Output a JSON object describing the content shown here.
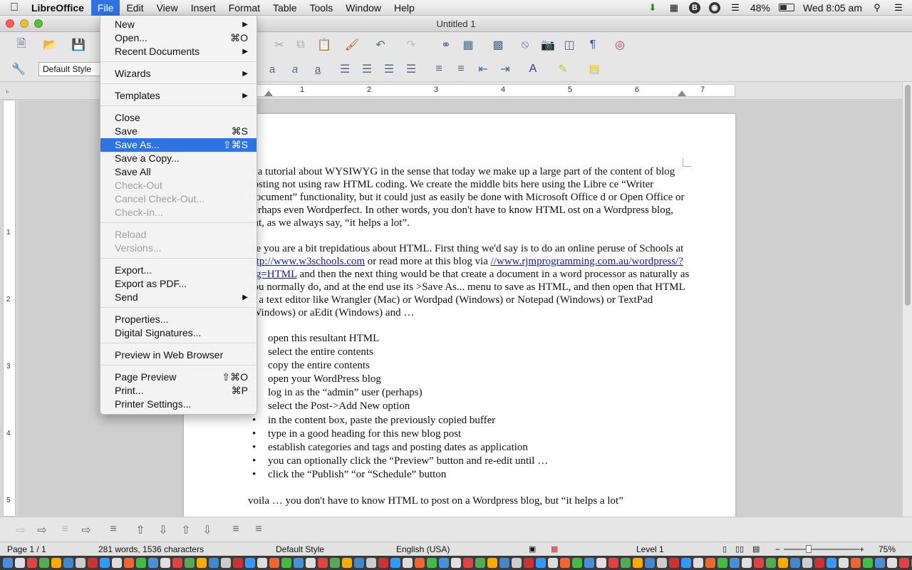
{
  "menubar": {
    "app_name": "LibreOffice",
    "menus": [
      "File",
      "Edit",
      "View",
      "Insert",
      "Format",
      "Table",
      "Tools",
      "Window",
      "Help"
    ],
    "active_menu": "File",
    "battery": "48%",
    "battery_level": 0.48,
    "clock": "Wed 8:05 am"
  },
  "window": {
    "title": "Untitled 1"
  },
  "toolbar": {
    "paragraph_style": "Default Style"
  },
  "ruler": {
    "numbers": [
      "1",
      "2",
      "3",
      "4",
      "5",
      "6",
      "7"
    ]
  },
  "vruler": {
    "numbers": [
      "1",
      "2",
      "3",
      "4",
      "5"
    ]
  },
  "file_menu": {
    "items": [
      {
        "label": "New",
        "shortcut": "",
        "submenu": true,
        "enabled": true
      },
      {
        "label": "Open...",
        "shortcut": "⌘O",
        "submenu": false,
        "enabled": true
      },
      {
        "label": "Recent Documents",
        "shortcut": "",
        "submenu": true,
        "enabled": true
      },
      {
        "label": "Wizards",
        "shortcut": "",
        "submenu": true,
        "enabled": true
      },
      {
        "label": "Templates",
        "shortcut": "",
        "submenu": true,
        "enabled": true
      },
      {
        "label": "Close",
        "shortcut": "",
        "submenu": false,
        "enabled": true
      },
      {
        "label": "Save",
        "shortcut": "⌘S",
        "submenu": false,
        "enabled": true
      },
      {
        "label": "Save As...",
        "shortcut": "⇧⌘S",
        "submenu": false,
        "enabled": true,
        "highlighted": true
      },
      {
        "label": "Save a Copy...",
        "shortcut": "",
        "submenu": false,
        "enabled": true
      },
      {
        "label": "Save All",
        "shortcut": "",
        "submenu": false,
        "enabled": true
      },
      {
        "label": "Check-Out",
        "shortcut": "",
        "submenu": false,
        "enabled": false
      },
      {
        "label": "Cancel Check-Out...",
        "shortcut": "",
        "submenu": false,
        "enabled": false
      },
      {
        "label": "Check-In...",
        "shortcut": "",
        "submenu": false,
        "enabled": false
      },
      {
        "label": "Reload",
        "shortcut": "",
        "submenu": false,
        "enabled": false
      },
      {
        "label": "Versions...",
        "shortcut": "",
        "submenu": false,
        "enabled": false
      },
      {
        "label": "Export...",
        "shortcut": "",
        "submenu": false,
        "enabled": true
      },
      {
        "label": "Export as PDF...",
        "shortcut": "",
        "submenu": false,
        "enabled": true
      },
      {
        "label": "Send",
        "shortcut": "",
        "submenu": true,
        "enabled": true
      },
      {
        "label": "Properties...",
        "shortcut": "",
        "submenu": false,
        "enabled": true
      },
      {
        "label": "Digital Signatures...",
        "shortcut": "",
        "submenu": false,
        "enabled": true
      },
      {
        "label": "Preview in Web Browser",
        "shortcut": "",
        "submenu": false,
        "enabled": true
      },
      {
        "label": "Page Preview",
        "shortcut": "⇧⌘O",
        "submenu": false,
        "enabled": true
      },
      {
        "label": "Print...",
        "shortcut": "⌘P",
        "submenu": false,
        "enabled": true
      },
      {
        "label": "Printer Settings...",
        "shortcut": "",
        "submenu": false,
        "enabled": true
      }
    ]
  },
  "document": {
    "para1": " is a tutorial about WYSIWYG in the sense that today we make up a large part of the content of blog posting not using raw HTML coding.  We create the middle bits here using the Libre ce “Writer Document” functionality, but it could just as easily be done with Microsoft Office d or Open Office or perhaps even Wordperfect.  In other words, you don't have to know HTML ost on a Wordpress blog, but, as we always say, “it helps a lot”.",
    "para2_a": "ere you are a bit trepidatious about HTML.  First thing we'd say is to do an online peruse of Schools at ",
    "link1": "http://www.w3schools.com",
    "para2_b": " or read more at this blog via ",
    "link2": "//www.rjmprogramming.com.au/wordpress/?tag=HTML",
    "para2_c": " and then the next thing would be that create a document in a word processor as naturally as you normally do, and at the end use its >Save As... menu to save as HTML, and then open that HTML in a text editor like Wrangler (Mac) or Wordpad (Windows) or Notepad (Windows) or TextPad (Windows) or aEdit (Windows) and …",
    "bullets": [
      "open this resultant HTML",
      "select the entire contents",
      "copy the entire contents",
      "open your WordPress blog",
      "log in as the “admin” user (perhaps)",
      "select the Post->Add New option",
      "in the content box, paste the previously copied buffer",
      "type in a good heading for this new blog post",
      "establish categories and tags and posting dates as application",
      "you can optionally click the “Preview” button and re-edit until …",
      "click the “Publish” “or “Schedule” button"
    ],
    "closing": "voila … you don't have to know HTML to post on a Wordpress blog, but “it helps a lot”"
  },
  "statusbar": {
    "page": "Page 1 / 1",
    "counts": "281 words, 1536 characters",
    "style": "Default Style",
    "language": "English (USA)",
    "level": "Level 1",
    "zoom": "75%"
  }
}
